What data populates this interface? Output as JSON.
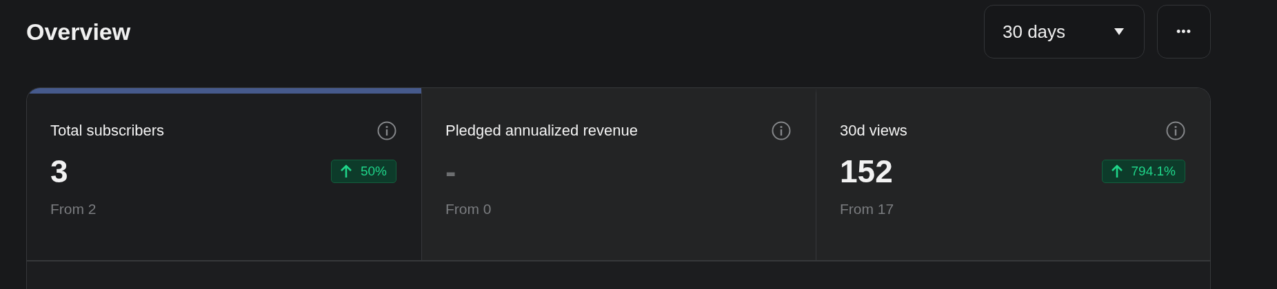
{
  "header": {
    "title": "Overview",
    "range": {
      "value": "30 days"
    },
    "more_button": {
      "label": "•••"
    }
  },
  "cards": [
    {
      "title": "Total subscribers",
      "value": "3",
      "dimmed": false,
      "change": "50%",
      "from": "From 2",
      "selected": true
    },
    {
      "title": "Pledged annualized revenue",
      "value": "-",
      "dimmed": true,
      "from": "From 0",
      "selected": false
    },
    {
      "title": "30d views",
      "value": "152",
      "dimmed": false,
      "change": "794.1%",
      "from": "From 17",
      "selected": false
    }
  ]
}
